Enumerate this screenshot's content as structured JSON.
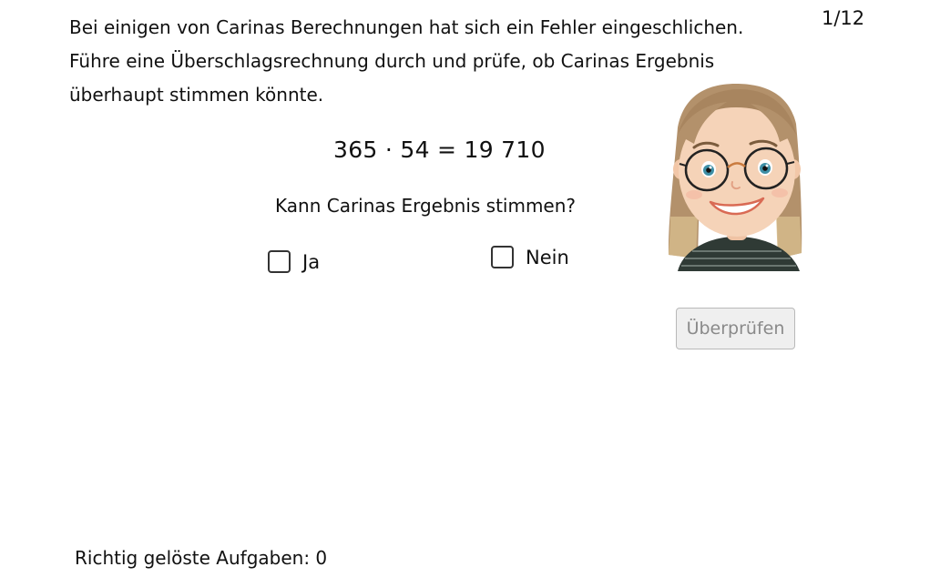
{
  "task": {
    "instruction_lines": [
      "Bei einigen von Carinas Berechnungen hat sich ein Fehler eingeschlichen.",
      "Führe eine Überschlagsrechnung durch und prüfe, ob Carinas Ergebnis",
      "überhaupt stimmen könnte."
    ],
    "counter": "1/12",
    "equation": "365 · 54 = 19 710",
    "question": "Kann Carinas Ergebnis stimmen?"
  },
  "options": {
    "yes_label": "Ja",
    "no_label": "Nein",
    "yes_checked": false,
    "no_checked": false
  },
  "check_button": {
    "label": "Überprüfen",
    "enabled": false
  },
  "avatar": {
    "icon": "girl-with-glasses-avatar",
    "hair_color": "#b3906a",
    "skin_color": "#f5d3b8"
  },
  "score": {
    "label": "Richtig gelöste Aufgaben: 0"
  }
}
